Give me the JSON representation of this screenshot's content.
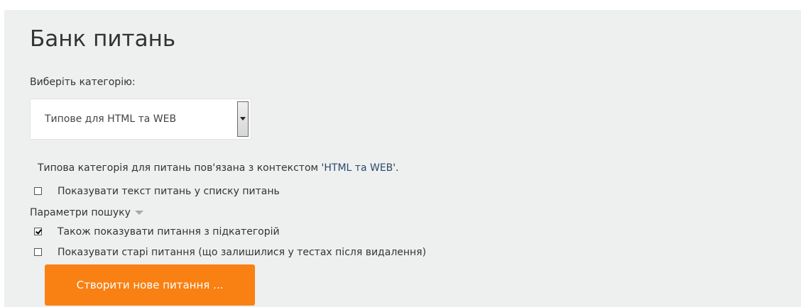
{
  "page": {
    "title": "Банк питань"
  },
  "category_select": {
    "label": "Виберіть категорію:",
    "selected": "Типове для HTML та WEB"
  },
  "info": {
    "prefix": "Типова категорія для питань пов'язана з контекстом '",
    "context_name": "HTML та WEB",
    "suffix": "'."
  },
  "options": {
    "show_text": {
      "label": "Показувати текст питань у списку питань",
      "checked": false
    },
    "search_params_label": "Параметри пошуку",
    "include_subcategories": {
      "label": "Також показувати питання з підкатегорій",
      "checked": true
    },
    "show_hidden": {
      "label": "Показувати старі питання (що залишилися у тестах після видалення)",
      "checked": false
    }
  },
  "actions": {
    "create_label": "Створити нове питання ..."
  },
  "colors": {
    "panel_bg": "#eeefef",
    "button_bg": "#f98012",
    "link": "#2a4a6a"
  }
}
